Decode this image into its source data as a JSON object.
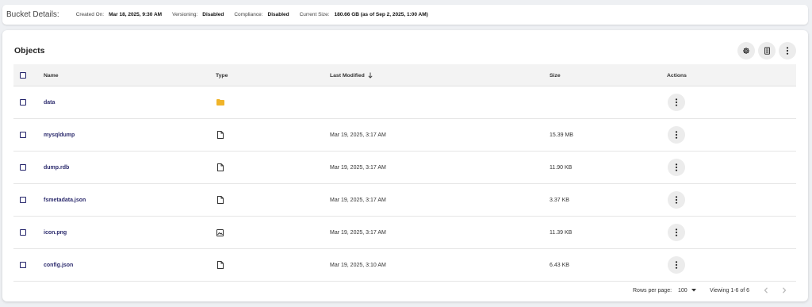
{
  "details": {
    "title": "Bucket Details:",
    "created_label": "Created On:",
    "created_value": "Mar 18, 2025, 9:30 AM",
    "versioning_label": "Versioning:",
    "versioning_value": "Disabled",
    "compliance_label": "Compliance:",
    "compliance_value": "Disabled",
    "size_label": "Current Size:",
    "size_value": "180.66 GB (as of Sep 2, 2025, 1:00 AM)"
  },
  "objects": {
    "title": "Objects",
    "toolbar_icons": [
      "gear-icon",
      "calculator-icon",
      "more-vert-icon"
    ],
    "columns": {
      "name": "Name",
      "type": "Type",
      "modified": "Last Modified",
      "size": "Size",
      "actions": "Actions"
    },
    "sort": {
      "column": "Last Modified",
      "direction": "descending"
    },
    "rows": [
      {
        "name": "data",
        "type": "folder-icon",
        "modified": "",
        "size": ""
      },
      {
        "name": "mysqldump",
        "type": "file-icon",
        "modified": "Mar 19, 2025, 3:17 AM",
        "size": "15.39 MB"
      },
      {
        "name": "dump.rdb",
        "type": "file-icon",
        "modified": "Mar 19, 2025, 3:17 AM",
        "size": "11.90 KB"
      },
      {
        "name": "fsmetadata.json",
        "type": "file-icon",
        "modified": "Mar 19, 2025, 3:17 AM",
        "size": "3.37 KB"
      },
      {
        "name": "icon.png",
        "type": "image-icon",
        "modified": "Mar 19, 2025, 3:17 AM",
        "size": "11.39 KB"
      },
      {
        "name": "config.json",
        "type": "file-icon",
        "modified": "Mar 19, 2025, 3:10 AM",
        "size": "6.43 KB"
      }
    ]
  },
  "pagination": {
    "rows_per_page_label": "Rows per page:",
    "rows_per_page_value": "100",
    "viewing": "Viewing 1-6 of 6"
  },
  "colors": {
    "link": "#2d2c6e",
    "folder": "#f0b429",
    "checkbox": "#23236a"
  }
}
